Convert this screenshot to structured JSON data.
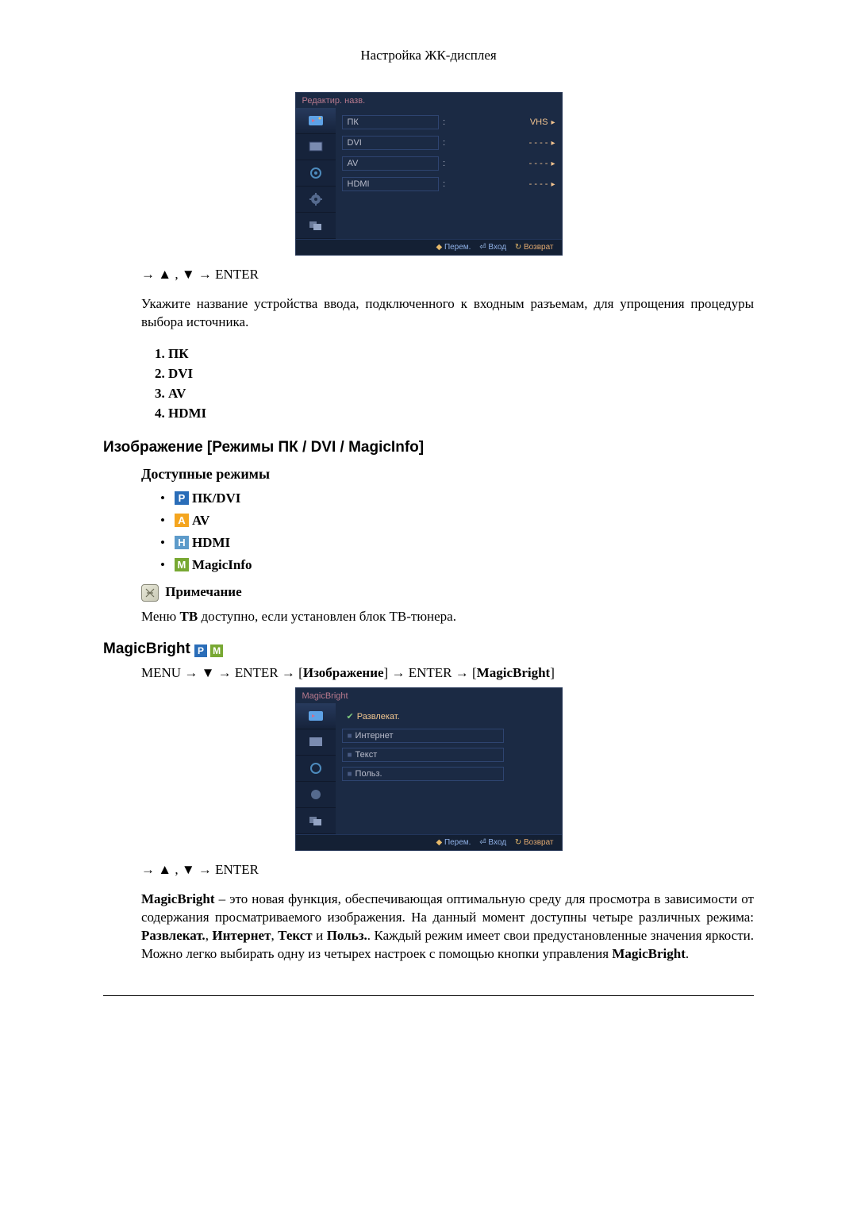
{
  "header": "Настройка ЖК-дисплея",
  "osd1": {
    "title": "Редактир. назв.",
    "rows": [
      {
        "label": "ПК",
        "value": "VHS",
        "has_chevron": true
      },
      {
        "label": "DVI",
        "value": "- - - -",
        "has_chevron": true
      },
      {
        "label": "AV",
        "value": "- - - -",
        "has_chevron": true
      },
      {
        "label": "HDMI",
        "value": "- - - -",
        "has_chevron": true
      }
    ],
    "footer": {
      "move": "Перем.",
      "enter": "Вход",
      "back": "Возврат"
    }
  },
  "nav1": "→ ▲ , ▼ → ENTER",
  "desc1": "Укажите название устройства ввода, подключенного к входным разъемам, для упрощения процедуры выбора источника.",
  "list": [
    "ПК",
    "DVI",
    "AV",
    "HDMI"
  ],
  "section_heading": "Изображение [Режимы ПК / DVI / MagicInfo]",
  "sub_heading": "Доступные режимы",
  "modes": {
    "pkdvi": "ПК/DVI",
    "av": "AV",
    "hdmi": "HDMI",
    "magic": "MagicInfo"
  },
  "note_label": "Примечание",
  "note_text_a": "Меню ",
  "note_text_b": "ТВ",
  "note_text_c": " доступно, если установлен блок ТВ-тюнера.",
  "mb_heading": "MagicBright",
  "menu_path": {
    "menu": "MENU",
    "dn": "▼",
    "enter": "ENTER",
    "img": "Изображение",
    "mb": "MagicBright"
  },
  "osd2": {
    "title": "MagicBright",
    "rows": [
      {
        "label": "Развлекат.",
        "checked": true
      },
      {
        "label": "Интернет"
      },
      {
        "label": "Текст"
      },
      {
        "label": "Польз."
      }
    ]
  },
  "nav2": "→ ▲ , ▼ → ENTER",
  "desc2_parts": {
    "b1": "MagicBright",
    "t1": " – это новая функция, обеспечивающая оптимальную среду для просмотра в зависимости от содержания просматриваемого изображения. На данный момент доступны четыре различных режима: ",
    "b2": "Развлекат.",
    "t2": ", ",
    "b3": "Интернет",
    "t3": ", ",
    "b4": "Текст",
    "t4": " и ",
    "b5": "Польз.",
    "t5": ". Каждый режим имеет свои предустановленные значения яркости. Можно легко выбирать одну из четырех настроек с помощью кнопки управления ",
    "b6": "MagicBright",
    "t6": "."
  }
}
